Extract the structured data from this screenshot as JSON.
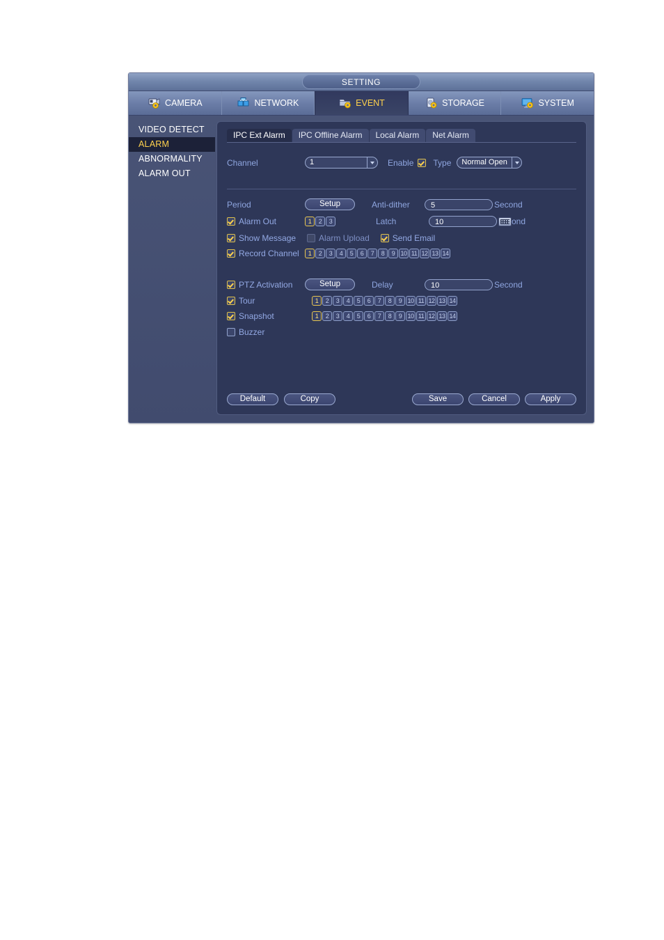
{
  "window": {
    "title": "SETTING"
  },
  "main_menu": [
    {
      "label": "CAMERA",
      "icon": "camera-gear-icon",
      "active": false
    },
    {
      "label": "NETWORK",
      "icon": "network-icon",
      "active": false
    },
    {
      "label": "EVENT",
      "icon": "event-gear-icon",
      "active": true
    },
    {
      "label": "STORAGE",
      "icon": "storage-gear-icon",
      "active": false
    },
    {
      "label": "SYSTEM",
      "icon": "system-gear-icon",
      "active": false
    }
  ],
  "sidebar": {
    "items": [
      {
        "label": "VIDEO DETECT",
        "active": false
      },
      {
        "label": "ALARM",
        "active": true
      },
      {
        "label": "ABNORMALITY",
        "active": false
      },
      {
        "label": "ALARM OUT",
        "active": false
      }
    ]
  },
  "tabs": [
    {
      "label": "IPC Ext Alarm",
      "active": true
    },
    {
      "label": "IPC Offline Alarm",
      "active": false
    },
    {
      "label": "Local Alarm",
      "active": false
    },
    {
      "label": "Net Alarm",
      "active": false
    }
  ],
  "form": {
    "channel_label": "Channel",
    "channel_value": "1",
    "enable_label": "Enable",
    "enable_checked": true,
    "type_label": "Type",
    "type_value": "Normal Open",
    "period_label": "Period",
    "period_button": "Setup",
    "antidither_label": "Anti-dither",
    "antidither_value": "5",
    "antidither_unit": "Second",
    "alarm_out_label": "Alarm Out",
    "alarm_out_checked": true,
    "alarm_out_channels": [
      "1",
      "2",
      "3"
    ],
    "alarm_out_selected": [
      1
    ],
    "latch_label": "Latch",
    "latch_value": "10",
    "latch_unit": "ond",
    "latch_keyboard_icon": "keyboard-icon",
    "show_message_label": "Show Message",
    "show_message_checked": true,
    "alarm_upload_label": "Alarm Upload",
    "alarm_upload_checked": false,
    "alarm_upload_disabled": true,
    "send_email_label": "Send Email",
    "send_email_checked": true,
    "record_channel_label": "Record Channel",
    "record_channel_checked": true,
    "record_channels": [
      "1",
      "2",
      "3",
      "4",
      "5",
      "6",
      "7",
      "8",
      "9",
      "10",
      "11",
      "12",
      "13",
      "14"
    ],
    "record_channels_selected": [
      1
    ],
    "ptz_activation_label": "PTZ Activation",
    "ptz_activation_checked": true,
    "ptz_button": "Setup",
    "delay_label": "Delay",
    "delay_value": "10",
    "delay_unit": "Second",
    "tour_label": "Tour",
    "tour_checked": true,
    "tour_channels": [
      "1",
      "2",
      "3",
      "4",
      "5",
      "6",
      "7",
      "8",
      "9",
      "10",
      "11",
      "12",
      "13",
      "14"
    ],
    "tour_selected": [
      1
    ],
    "snapshot_label": "Snapshot",
    "snapshot_checked": true,
    "snapshot_channels": [
      "1",
      "2",
      "3",
      "4",
      "5",
      "6",
      "7",
      "8",
      "9",
      "10",
      "11",
      "12",
      "13",
      "14"
    ],
    "snapshot_selected": [
      1
    ],
    "buzzer_label": "Buzzer",
    "buzzer_checked": false
  },
  "buttons": {
    "default": "Default",
    "copy": "Copy",
    "save": "Save",
    "cancel": "Cancel",
    "apply": "Apply"
  },
  "colors": {
    "accent_yellow": "#ffd24d",
    "label_blue": "#93a9e4",
    "panel_bg": "#2e3758",
    "window_bg": "#454f75"
  }
}
